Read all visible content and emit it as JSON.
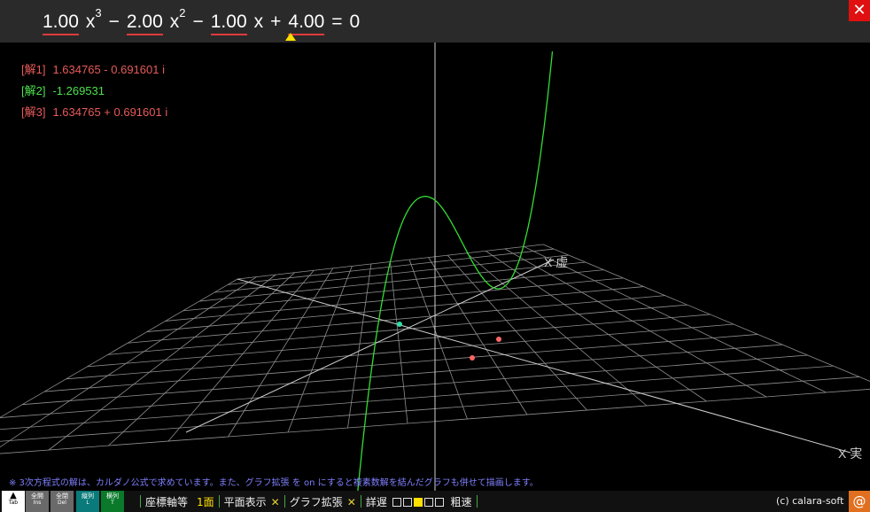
{
  "equation": {
    "a": "1.00",
    "x3": "x",
    "p3": "3",
    "op1": "−",
    "b": "2.00",
    "x2": "x",
    "p2": "2",
    "op2": "−",
    "c": "1.00",
    "x1": "x",
    "op3": "+",
    "d": "4.00",
    "eq": "=",
    "rhs": "0"
  },
  "close_symbol": "✕",
  "solutions": [
    {
      "label": "[解1]",
      "value": "1.634765 - 0.691601 i"
    },
    {
      "label": "[解2]",
      "value": "-1.269531"
    },
    {
      "label": "[解3]",
      "value": "1.634765 + 0.691601 i"
    }
  ],
  "axes": {
    "x_imag": "X 虚",
    "x_real": "X 実"
  },
  "note": "※ 3次方程式の解は、カルダノ公式で求めています。また、グラフ拡張 を on にすると複素数解を結んだグラフも併せて描画します。",
  "buttons": {
    "tab": {
      "label": "▲",
      "key": "Tab"
    },
    "all_open": {
      "label": "全開",
      "key": "Ins"
    },
    "all_close": {
      "label": "全閉",
      "key": "Del"
    },
    "vertical": {
      "label": "縦列",
      "key": "L"
    },
    "horizontal": {
      "label": "横列",
      "key": "T"
    }
  },
  "menu": {
    "axes": "座標軸等",
    "face": "1面",
    "plane": "平面表示",
    "plane_x": "✕",
    "graph_ext": "グラフ拡張",
    "graph_x": "✕",
    "detail": "詳遅",
    "rough": "粗速"
  },
  "copyright": "(c) calara-soft",
  "at_symbol": "@",
  "colors": {
    "curve": "#33dd33",
    "grid": "#9a9a9a",
    "root_real": "#33ddaa",
    "root_complex": "#ff6666",
    "accent_red": "#e01010"
  }
}
